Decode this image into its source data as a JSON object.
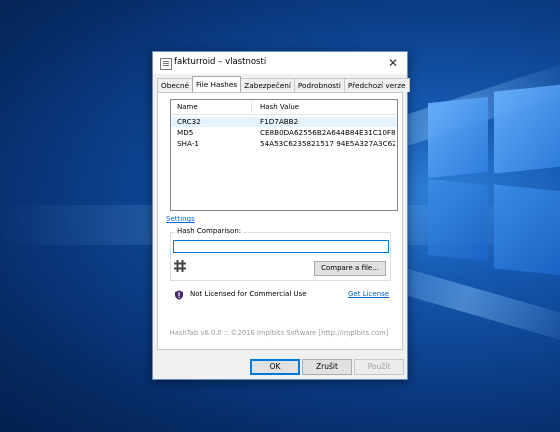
{
  "window": {
    "title": "fakturroid – vlastnosti",
    "close_glyph": "✕"
  },
  "tabs": [
    {
      "label": "Obecné",
      "active": false
    },
    {
      "label": "File Hashes",
      "active": true
    },
    {
      "label": "Zabezpečení",
      "active": false
    },
    {
      "label": "Podrobnosti",
      "active": false
    },
    {
      "label": "Předchozí verze",
      "active": false
    }
  ],
  "hash_list": {
    "columns": {
      "name": "Name",
      "value": "Hash Value"
    },
    "rows": [
      {
        "name": "CRC32",
        "value": "F1D7ABB2",
        "selected": true
      },
      {
        "name": "MD5",
        "value": "CE8B0DA62556B2A644B84E31C10F8",
        "selected": false
      },
      {
        "name": "SHA-1",
        "value": "54A53C6235821517 94E5A327A3C62D",
        "selected": false
      }
    ]
  },
  "settings_link": "Settings",
  "hash_comparison": {
    "label": "Hash Comparison:",
    "input_value": "",
    "compare_button": "Compare a file...",
    "icon": "hash-icon"
  },
  "license": {
    "icon": "shield-icon",
    "text": "Not Licensed for Commercial Use",
    "link": "Get License"
  },
  "footer": "HashTab v6.0.0 :: ©2016 Implbits Software [http://implbits.com]",
  "buttons": {
    "ok": "OK",
    "cancel": "Zrušit",
    "apply": "Použít"
  },
  "colors": {
    "link": "#0066cc",
    "accent": "#0078d7",
    "selected_row": "#e5f3ff"
  }
}
